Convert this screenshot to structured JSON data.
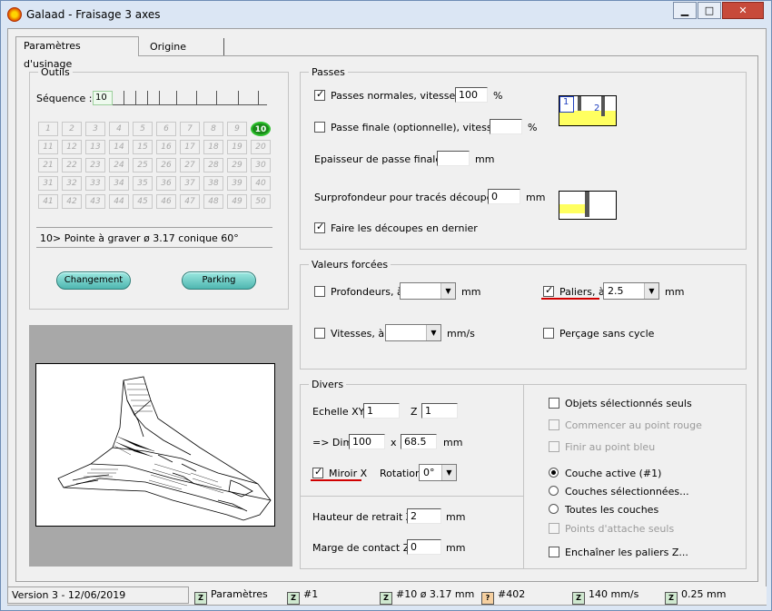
{
  "window": {
    "title": "Galaad  -  Fraisage 3 axes",
    "min": "▁",
    "max": "□",
    "close": "✕"
  },
  "tabs": [
    {
      "label": "Paramètres d'usinage"
    },
    {
      "label": "Origine pièce"
    }
  ],
  "outils": {
    "label": "Outils",
    "sequence_label": "Séquence :",
    "sequence_value": "10",
    "tools": [
      "1",
      "2",
      "3",
      "4",
      "5",
      "6",
      "7",
      "8",
      "9",
      "10",
      "11",
      "12",
      "13",
      "14",
      "15",
      "16",
      "17",
      "18",
      "19",
      "20",
      "21",
      "22",
      "23",
      "24",
      "25",
      "26",
      "27",
      "28",
      "29",
      "30",
      "31",
      "32",
      "33",
      "34",
      "35",
      "36",
      "37",
      "38",
      "39",
      "40",
      "41",
      "42",
      "43",
      "44",
      "45",
      "46",
      "47",
      "48",
      "49",
      "50"
    ],
    "selected_tool": "10",
    "tool_info": "10>  Pointe à graver   ø 3.17    conique 60°",
    "changement": "Changement",
    "parking": "Parking"
  },
  "passes": {
    "label": "Passes",
    "normales_label": "Passes normales, vitesse à",
    "normales_value": "100",
    "normales_unit": "%",
    "finale_label": "Passe finale (optionnelle), vitesse à",
    "finale_value": "",
    "finale_unit": "%",
    "epaisseur_label": "Epaisseur de passe finale :",
    "epaisseur_value": "",
    "epaisseur_unit": "mm",
    "surprof_label": "Surprofondeur pour tracés découpés :",
    "surprof_value": "0",
    "surprof_unit": "mm",
    "decoupes_label": "Faire les découpes en dernier",
    "img_num1": "1",
    "img_num2": "2"
  },
  "forcees": {
    "label": "Valeurs forcées",
    "prof_label": "Profondeurs, à",
    "prof_value": "",
    "prof_unit": "mm",
    "paliers_label": "Paliers, à",
    "paliers_value": "2.5",
    "paliers_unit": "mm",
    "vit_label": "Vitesses, à",
    "vit_value": "",
    "vit_unit": "mm/s",
    "percage_label": "Perçage sans cycle"
  },
  "divers": {
    "label": "Divers",
    "echelle_label": "Echelle XY",
    "echelle_value": "1",
    "z_label": "Z",
    "z_value": "1",
    "dim_label": "=> Dim.",
    "dim_x": "100",
    "dim_sep": "x",
    "dim_y": "68.5",
    "dim_unit": "mm",
    "miroir_label": "Miroir X",
    "rotation_label": "Rotation",
    "rotation_value": "0°",
    "retrait_label": "Hauteur de retrait Z :",
    "retrait_value": "2",
    "retrait_unit": "mm",
    "marge_label": "Marge de contact Z :",
    "marge_value": "0",
    "marge_unit": "mm",
    "objets_label": "Objets sélectionnés seuls",
    "commencer_label": "Commencer au point rouge",
    "finir_label": "Finir au point bleu",
    "couche_active_label": "Couche active (#1)",
    "couches_sel_label": "Couches sélectionnées...",
    "toutes_label": "Toutes les couches",
    "attache_label": "Points d'attache seuls",
    "enchainer_label": "Enchaîner les paliers Z..."
  },
  "status": {
    "version": "Version 3 - 12/06/2019",
    "params": "Paramètres",
    "layer": "#1",
    "tool": "#10   ø 3.17 mm",
    "count": "#402",
    "speed": "140 mm/s",
    "depth": "0.25 mm"
  }
}
